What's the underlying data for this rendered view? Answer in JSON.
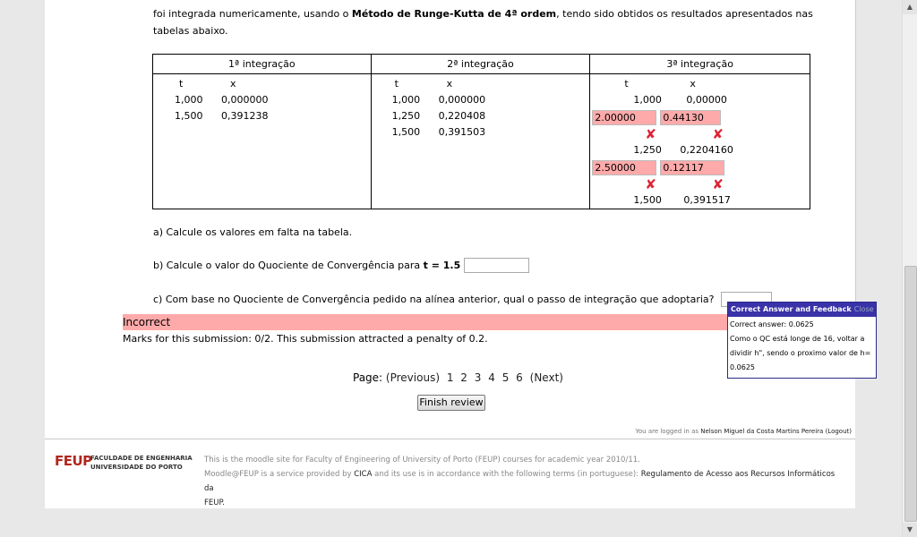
{
  "intro": {
    "text1": "foi integrada numericamente, usando o ",
    "method": "Método de Runge-Kutta de 4ª ordem",
    "text2": ", tendo sido obtidos os resultados apresentados nas",
    "text3": "tabelas abaixo."
  },
  "table": {
    "headers": [
      "1ª integração",
      "2ª integração",
      "3ª integração"
    ],
    "col_t": "t",
    "col_x": "x",
    "int1": [
      [
        "1,000",
        "0,000000"
      ],
      [
        "1,500",
        "0,391238"
      ]
    ],
    "int2": [
      [
        "1,000",
        "0,000000"
      ],
      [
        "1,250",
        "0,220408"
      ],
      [
        "1,500",
        "0,391503"
      ]
    ],
    "int3": {
      "row1": [
        "1,000",
        "0,00000"
      ],
      "input1_t": "2.00000",
      "input1_x": "0.44130",
      "row2": [
        "1,250",
        "0,2204160"
      ],
      "input2_t": "2.50000",
      "input2_x": "0.12117",
      "row3": [
        "1,500",
        "0,391517"
      ],
      "wrong_mark": "✘"
    }
  },
  "questions": {
    "a": "a) Calcule os valores em falta na tabela.",
    "b_pre": "b) Calcule o valor do Quociente de Convergência para ",
    "b_bold": "t = 1.5",
    "c": "c) Com base no Quociente de Convergência pedido na alínea anterior, qual o passo de integração que adoptaria?"
  },
  "result": {
    "status": "Incorrect",
    "marks": "Marks for this submission: 0/2. This submission attracted a penalty of 0.2."
  },
  "popup": {
    "title": "Correct Answer and Feedback",
    "close": "Close",
    "line1": "Correct answer: 0.0625",
    "line2": "Como o QC está longe de 16, voltar a",
    "line3": "dividir h\", sendo o proximo valor de h=",
    "line4": "0.0625"
  },
  "pager": {
    "label": "Page:",
    "prev": "(Previous)",
    "pages": [
      "1",
      "2",
      "3",
      "4",
      "5",
      "6"
    ],
    "next": "(Next)"
  },
  "finish_button": "Finish review",
  "login": {
    "prefix": "You are logged in as ",
    "user": "Nelson Miguel da Costa Martins Pereira",
    "logout": "(Logout)"
  },
  "footer": {
    "logo_big": "FEUP",
    "logo_line1": "FACULDADE DE ENGENHARIA",
    "logo_line2": "UNIVERSIDADE DO PORTO",
    "line1": "This is the moodle site for Faculty of Engineering of University of Porto (FEUP) courses for academic year 2010/11.",
    "line2_pre": "Moodle@FEUP is a service provided by ",
    "cica": "CICA",
    "line2_mid": " and its use is in accordance with the following terms (in portuguese): ",
    "regulation": "Regulamento de Acesso aos Recursos Informáticos da",
    "line3": "FEUP."
  }
}
